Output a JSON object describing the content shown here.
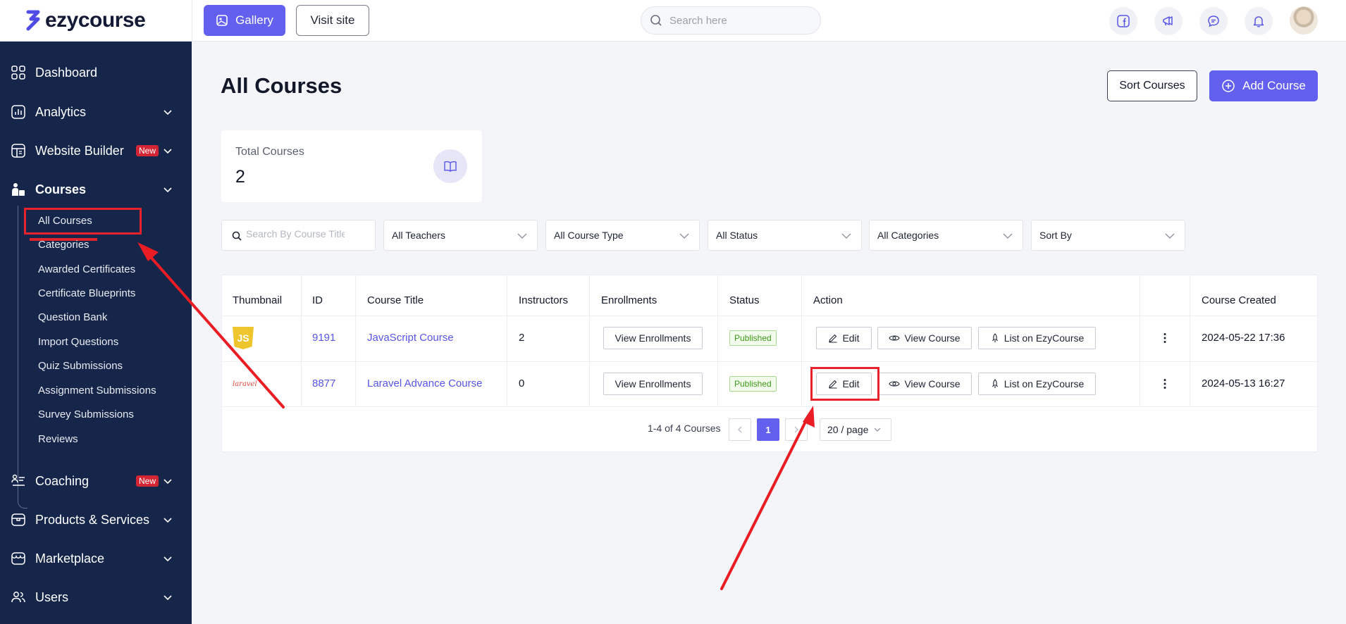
{
  "brand": {
    "name": "ezycourse"
  },
  "topbar": {
    "gallery_label": "Gallery",
    "visit_label": "Visit site",
    "search_placeholder": "Search here",
    "icons": [
      "facebook-icon",
      "megaphone-icon",
      "chat-icon",
      "bell-icon"
    ]
  },
  "sidebar": {
    "items": [
      {
        "label": "Dashboard",
        "icon": "dashboard-grid-icon"
      },
      {
        "label": "Analytics",
        "icon": "analytics-icon"
      },
      {
        "label": "Website Builder",
        "icon": "website-builder-icon",
        "badge": "New"
      },
      {
        "label": "Courses",
        "icon": "courses-icon"
      },
      {
        "label": "Coaching",
        "icon": "coaching-icon",
        "badge": "New"
      },
      {
        "label": "Products & Services",
        "icon": "box-icon"
      },
      {
        "label": "Marketplace",
        "icon": "store-icon"
      },
      {
        "label": "Users",
        "icon": "users-icon"
      }
    ],
    "course_subitems": [
      "All Courses",
      "Categories",
      "Awarded Certificates",
      "Certificate Blueprints",
      "Question Bank",
      "Import Questions",
      "Quiz Submissions",
      "Assignment Submissions",
      "Survey Submissions",
      "Reviews"
    ]
  },
  "main": {
    "title": "All Courses",
    "sort_label": "Sort Courses",
    "add_label": "Add Course",
    "stat": {
      "label": "Total Courses",
      "value": "2"
    },
    "filters": {
      "search_placeholder": "Search By Course Title",
      "teachers": "All Teachers",
      "course_type": "All Course Type",
      "status": "All Status",
      "categories": "All Categories",
      "sort": "Sort By"
    },
    "table": {
      "headers": [
        "Thumbnail",
        "ID",
        "Course Title",
        "Instructors",
        "Enrollments",
        "Status",
        "Action",
        "Course Created"
      ],
      "rows": [
        {
          "thumb": "JS",
          "id": "9191",
          "title": "JavaScript Course",
          "instructors": "2",
          "enroll_btn": "View Enrollments",
          "status": "Published",
          "edit": "Edit",
          "view": "View Course",
          "list": "List on EzyCourse",
          "created": "2024-05-22 17:36"
        },
        {
          "thumb": "laravel",
          "id": "8877",
          "title": "Laravel Advance Course",
          "instructors": "0",
          "enroll_btn": "View Enrollments",
          "status": "Published",
          "edit": "Edit",
          "view": "View Course",
          "list": "List on EzyCourse",
          "created": "2024-05-13 16:27"
        }
      ]
    },
    "pagination": {
      "info": "1-4 of 4 Courses",
      "current_page": "1",
      "page_size": "20 / page"
    }
  },
  "annotation_color": "#e8212b"
}
